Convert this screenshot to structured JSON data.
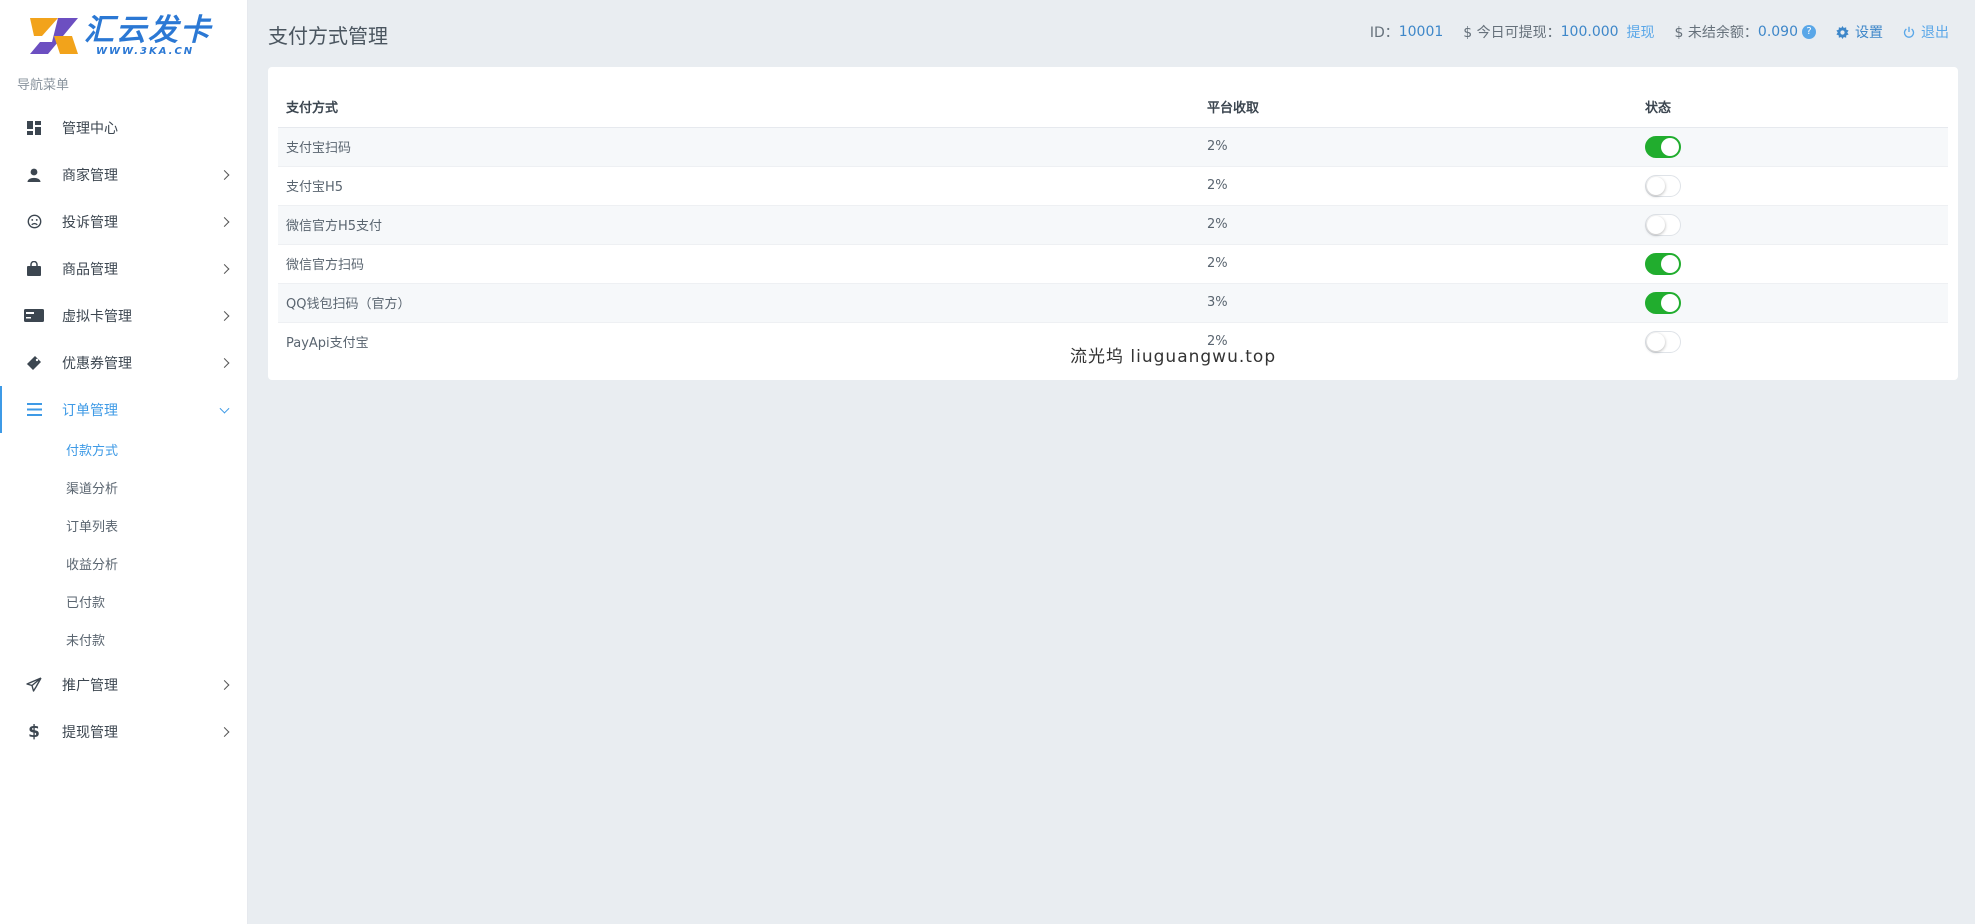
{
  "brand": {
    "name": "汇云发卡",
    "url": "WWW.3KA.CN"
  },
  "sidebar": {
    "title": "导航菜单",
    "items": [
      {
        "label": "管理中心",
        "icon": "dashboard-icon"
      },
      {
        "label": "商家管理",
        "icon": "user-icon"
      },
      {
        "label": "投诉管理",
        "icon": "frown-icon"
      },
      {
        "label": "商品管理",
        "icon": "shopping-bag-icon"
      },
      {
        "label": "虚拟卡管理",
        "icon": "card-icon"
      },
      {
        "label": "优惠券管理",
        "icon": "ticket-icon"
      },
      {
        "label": "订单管理",
        "icon": "list-icon"
      },
      {
        "label": "推广管理",
        "icon": "paper-plane-icon"
      },
      {
        "label": "提现管理",
        "icon": "dollar-icon"
      }
    ],
    "order_sub": [
      "付款方式",
      "渠道分析",
      "订单列表",
      "收益分析",
      "已付款",
      "未付款"
    ]
  },
  "header": {
    "title": "支付方式管理",
    "id_label": "ID：",
    "id_value": "10001",
    "withdraw_label": "$ 今日可提现：",
    "withdraw_value": "100.000",
    "withdraw_link": "提现",
    "unsettled_label": "$ 未结余额：",
    "unsettled_value": "0.090",
    "help_glyph": "?",
    "settings": "设置",
    "logout": "退出"
  },
  "table": {
    "headers": [
      "支付方式",
      "平台收取",
      "状态"
    ],
    "rows": [
      {
        "name": "支付宝扫码",
        "fee": "2%",
        "enabled": true
      },
      {
        "name": "支付宝H5",
        "fee": "2%",
        "enabled": false
      },
      {
        "name": "微信官方H5支付",
        "fee": "2%",
        "enabled": false
      },
      {
        "name": "微信官方扫码",
        "fee": "2%",
        "enabled": true
      },
      {
        "name": "QQ钱包扫码（官方）",
        "fee": "3%",
        "enabled": true
      },
      {
        "name": "PayApi支付宝",
        "fee": "2%",
        "enabled": false
      }
    ]
  },
  "watermark": "流光坞 liuguangwu.top",
  "colors": {
    "accent": "#3e9ae6",
    "toggle_on": "#21ad2e",
    "background": "#e9edf1"
  }
}
